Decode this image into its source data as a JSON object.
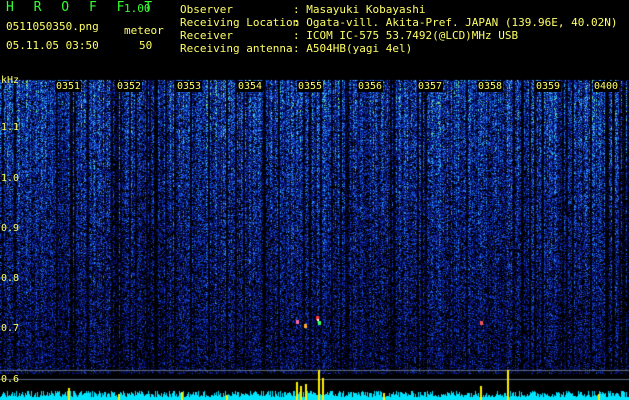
{
  "header": {
    "app_title": "H R O F F T",
    "version": "1.00",
    "filename": "0511050350.png",
    "datetime": "05.11.05 03:50",
    "meteor_label": "meteor",
    "meteor_count": "50",
    "fields": [
      {
        "label": "Observer",
        "value": ": Masayuki Kobayashi"
      },
      {
        "label": "Receiving Location",
        "value": ": Ogata-vill. Akita-Pref. JAPAN (139.96E, 40.02N)"
      },
      {
        "label": "Receiver",
        "value": ": ICOM IC-575 53.7492(@LCD)MHz USB"
      },
      {
        "label": "Receiving antenna",
        "value": ": A504HB(yagi 4el)"
      }
    ]
  },
  "spectrogram": {
    "y_unit": "kHz",
    "y_ticks": [
      "1.1",
      "1.0",
      "0.9",
      "0.8",
      "0.7",
      "0.6"
    ],
    "x_ticks": [
      "0351",
      "0352",
      "0353",
      "0354",
      "0355",
      "0356",
      "0357",
      "0358",
      "0359",
      "0400"
    ],
    "colors": {
      "background": "#000000",
      "text": "#ffff66",
      "title": "#33ff33",
      "baseline": "#00e5ff",
      "spike": "#ffee00"
    }
  }
}
